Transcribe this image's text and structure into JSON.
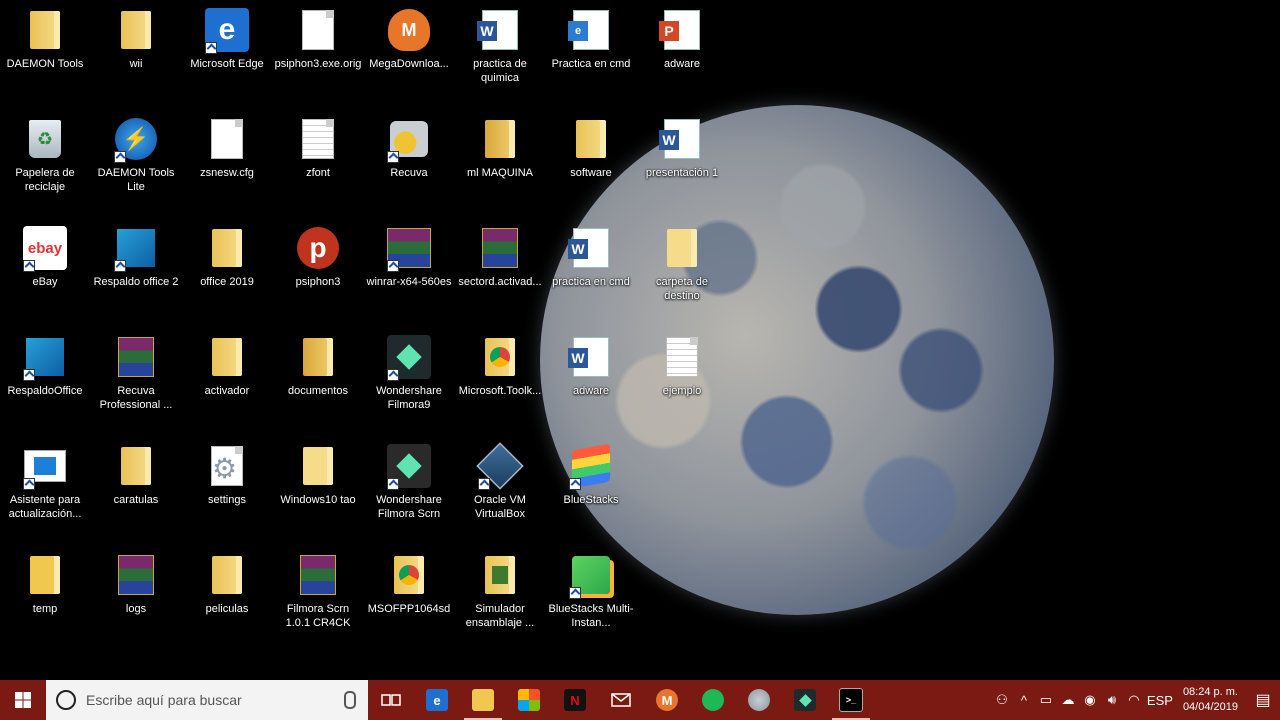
{
  "desktop": {
    "icons": [
      {
        "label": "DAEMON Tools"
      },
      {
        "label": "wii"
      },
      {
        "label": "Microsoft Edge"
      },
      {
        "label": "psiphon3.exe.orig"
      },
      {
        "label": "MegaDownloa..."
      },
      {
        "label": "practica de quimica"
      },
      {
        "label": "Practica en cmd"
      },
      {
        "label": "adware"
      },
      {
        "label": "Papelera de reciclaje"
      },
      {
        "label": "DAEMON Tools Lite"
      },
      {
        "label": "zsnesw.cfg"
      },
      {
        "label": "zfont"
      },
      {
        "label": "Recuva"
      },
      {
        "label": "ml MAQUINA"
      },
      {
        "label": "software"
      },
      {
        "label": "presentación 1"
      },
      {
        "label": "eBay"
      },
      {
        "label": "Respaldo office 2"
      },
      {
        "label": "office 2019"
      },
      {
        "label": "psiphon3"
      },
      {
        "label": "winrar-x64-560es"
      },
      {
        "label": "sectord.activad..."
      },
      {
        "label": "practica en cmd"
      },
      {
        "label": "carpeta de destino"
      },
      {
        "label": "RespaldoOffice"
      },
      {
        "label": "Recuva Professional ..."
      },
      {
        "label": "activador"
      },
      {
        "label": "documentos"
      },
      {
        "label": "Wondershare Filmora9"
      },
      {
        "label": "Microsoft.Toolk..."
      },
      {
        "label": "adware"
      },
      {
        "label": "ejemplo"
      },
      {
        "label": "Asistente para actualización..."
      },
      {
        "label": "caratulas"
      },
      {
        "label": "settings"
      },
      {
        "label": "Windows10 tao"
      },
      {
        "label": "Wondershare Filmora Scrn"
      },
      {
        "label": "Oracle VM VirtualBox"
      },
      {
        "label": "BlueStacks"
      },
      {
        "label": "temp"
      },
      {
        "label": "logs"
      },
      {
        "label": "peliculas"
      },
      {
        "label": "Filmora Scrn 1.0.1 CR4CK"
      },
      {
        "label": "MSOFPP1064sd"
      },
      {
        "label": "Simulador ensamblaje ..."
      },
      {
        "label": "BlueStacks Multi-Instan..."
      }
    ],
    "icon_text": {
      "edge": "e",
      "mega": "M",
      "word": "W",
      "ppt": "P",
      "pdf": "e",
      "ebay": "ebay",
      "psiphon": "p",
      "gear": "⚙"
    }
  },
  "taskbar": {
    "search_placeholder": "Escribe aquí para buscar",
    "apps": [
      "task-view",
      "edge",
      "file-explorer",
      "store",
      "netflix",
      "mail",
      "mega",
      "spotify",
      "recuva",
      "filmora",
      "cmd"
    ],
    "tray": {
      "language": "ESP",
      "time": "08:24 p. m.",
      "date": "04/04/2019"
    },
    "colors": {
      "taskbar": "#7a1a12",
      "search_bg": "#f3f3f3"
    }
  }
}
